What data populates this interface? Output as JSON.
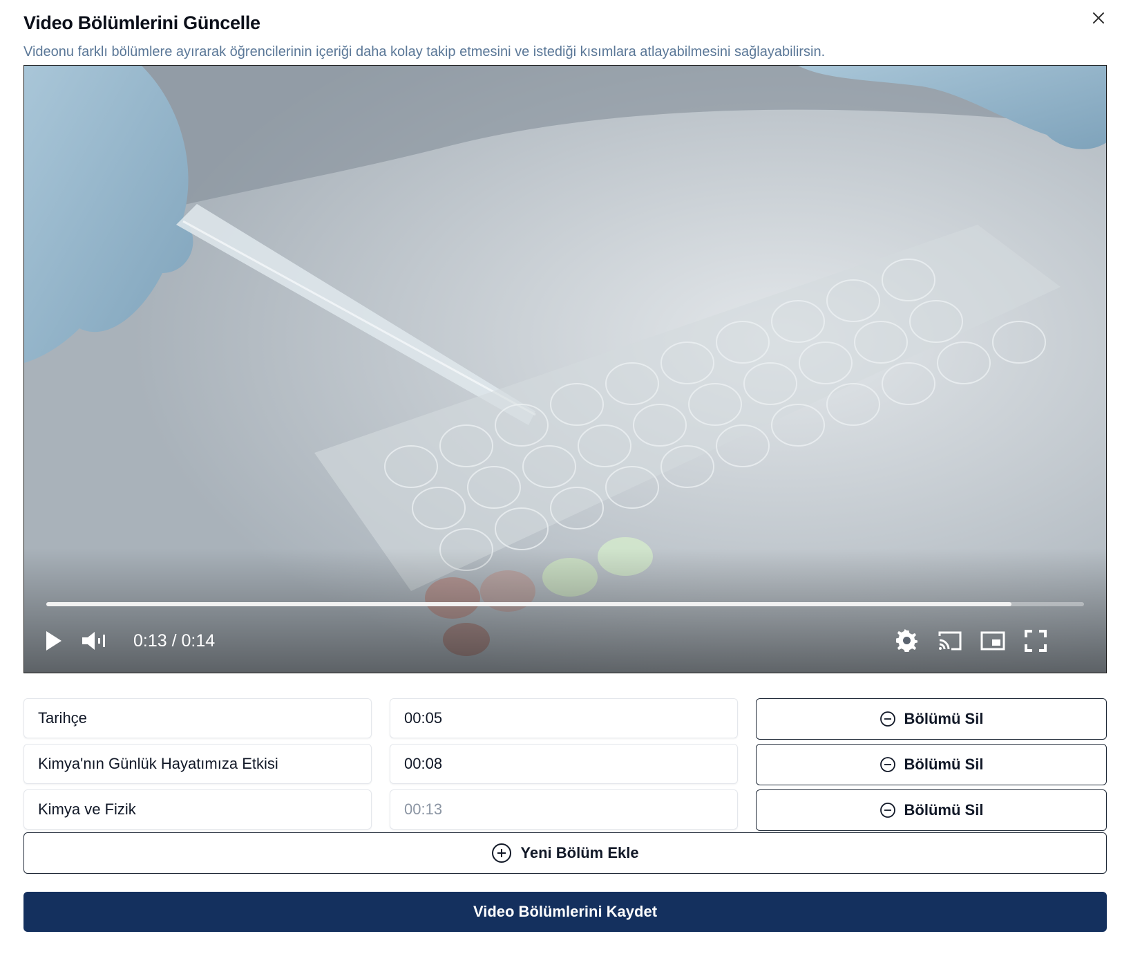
{
  "dialog": {
    "title": "Video Bölümlerini Güncelle",
    "subtitle": "Videonu farklı bölümlere ayırarak öğrencilerinin içeriği daha kolay takip etmesini ve istediği kısımlara atlayabilmesini sağlayabilirsin.",
    "close_icon": "close-icon"
  },
  "player": {
    "current_time": "0:13",
    "separator": " / ",
    "duration": "0:14",
    "progress": 0.93,
    "controls": [
      "play-icon",
      "volume-icon",
      "settings-icon",
      "cast-icon",
      "miniplayer-icon",
      "fullscreen-icon"
    ]
  },
  "chapters": [
    {
      "name": "Tarihçe",
      "time": "00:05",
      "delete_label": "Bölümü Sil"
    },
    {
      "name": "Kimya'nın Günlük Hayatımıza Etkisi",
      "time": "00:08",
      "delete_label": "Bölümü Sil"
    },
    {
      "name": "Kimya ve Fizik",
      "time": "00:13",
      "delete_label": "Bölümü Sil"
    }
  ],
  "actions": {
    "add_label": "Yeni Bölüm Ekle",
    "save_label": "Video Bölümlerini Kaydet"
  },
  "colors": {
    "primary": "#14305e",
    "subtitle": "#5a7797",
    "border": "#1f2937"
  }
}
